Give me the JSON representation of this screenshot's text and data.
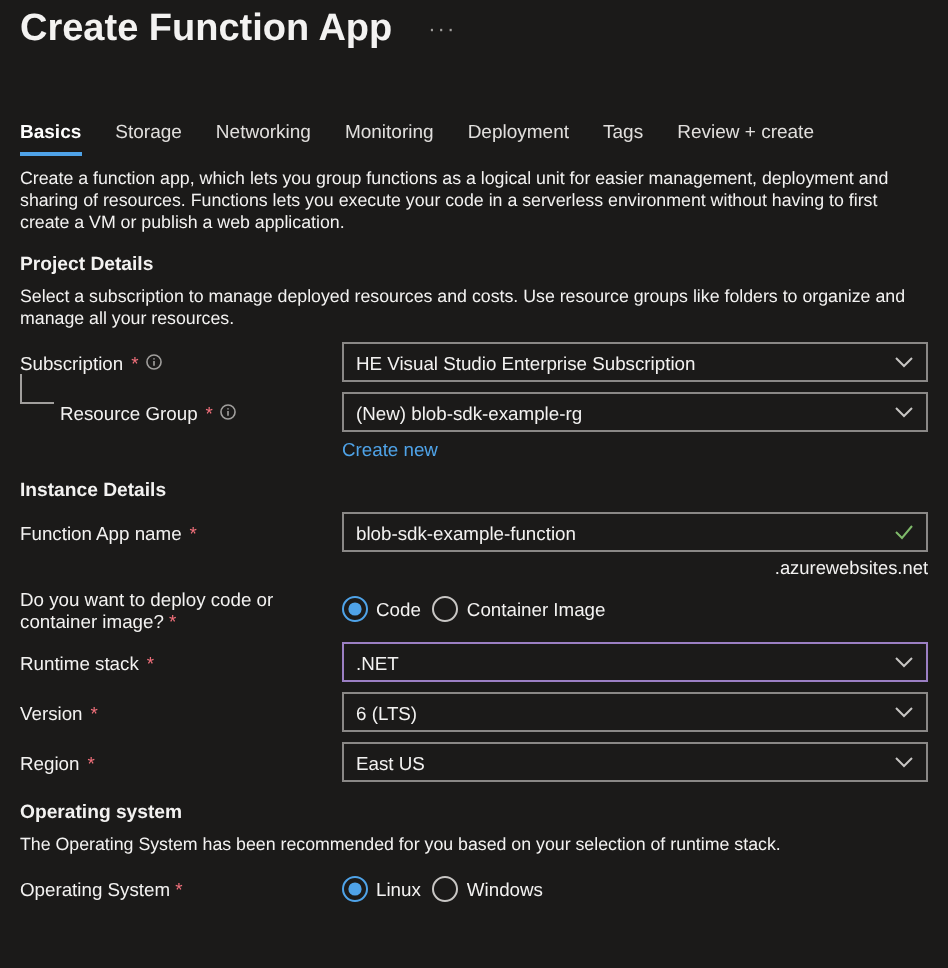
{
  "header": {
    "title": "Create Function App",
    "more": "···"
  },
  "tabs": [
    {
      "label": "Basics",
      "selected": true
    },
    {
      "label": "Storage",
      "selected": false
    },
    {
      "label": "Networking",
      "selected": false
    },
    {
      "label": "Monitoring",
      "selected": false
    },
    {
      "label": "Deployment",
      "selected": false
    },
    {
      "label": "Tags",
      "selected": false
    },
    {
      "label": "Review + create",
      "selected": false
    }
  ],
  "intro": "Create a function app, which lets you group functions as a logical unit for easier management, deployment and sharing of resources. Functions lets you execute your code in a serverless environment without having to first create a VM or publish a web application.",
  "sections": [
    {
      "title": "Project Details",
      "description": "Select a subscription to manage deployed resources and costs. Use resource groups like folders to organize and manage all your resources.",
      "fields": [
        {
          "kind": "select",
          "label": "Subscription",
          "asterisk": "*",
          "info": true,
          "nested": false,
          "focused": false,
          "value": "HE Visual Studio Enterprise Subscription"
        },
        {
          "kind": "select",
          "label": "Resource Group",
          "asterisk": "*",
          "info": true,
          "nested": true,
          "focused": false,
          "value": "(New) blob-sdk-example-rg",
          "link": "Create new"
        }
      ]
    },
    {
      "title": "Instance Details",
      "fields": [
        {
          "kind": "text",
          "label": "Function App name",
          "asterisk": "*",
          "info": false,
          "nested": false,
          "valid": true,
          "value": "blob-sdk-example-function",
          "suffix": ".azurewebsites.net"
        },
        {
          "kind": "radio",
          "label": "Do you want to deploy code or container image?",
          "asterisk": "*",
          "info": false,
          "nested": false,
          "options": [
            {
              "label": "Code",
              "selected": true
            },
            {
              "label": "Container Image",
              "selected": false
            }
          ]
        },
        {
          "kind": "select",
          "label": "Runtime stack",
          "asterisk": "*",
          "info": false,
          "nested": false,
          "focused": true,
          "value": ".NET"
        },
        {
          "kind": "select",
          "label": "Version",
          "asterisk": "*",
          "info": false,
          "nested": false,
          "focused": false,
          "value": "6 (LTS)"
        },
        {
          "kind": "select",
          "label": "Region",
          "asterisk": "*",
          "info": false,
          "nested": false,
          "focused": false,
          "value": "East US"
        }
      ]
    },
    {
      "title": "Operating system",
      "description": "The Operating System has been recommended for you based on your selection of runtime stack.",
      "fields": [
        {
          "kind": "radio",
          "label": "Operating System",
          "asterisk": "*",
          "info": false,
          "nested": false,
          "options": [
            {
              "label": "Linux",
              "selected": true
            },
            {
              "label": "Windows",
              "selected": false
            }
          ]
        }
      ]
    }
  ]
}
